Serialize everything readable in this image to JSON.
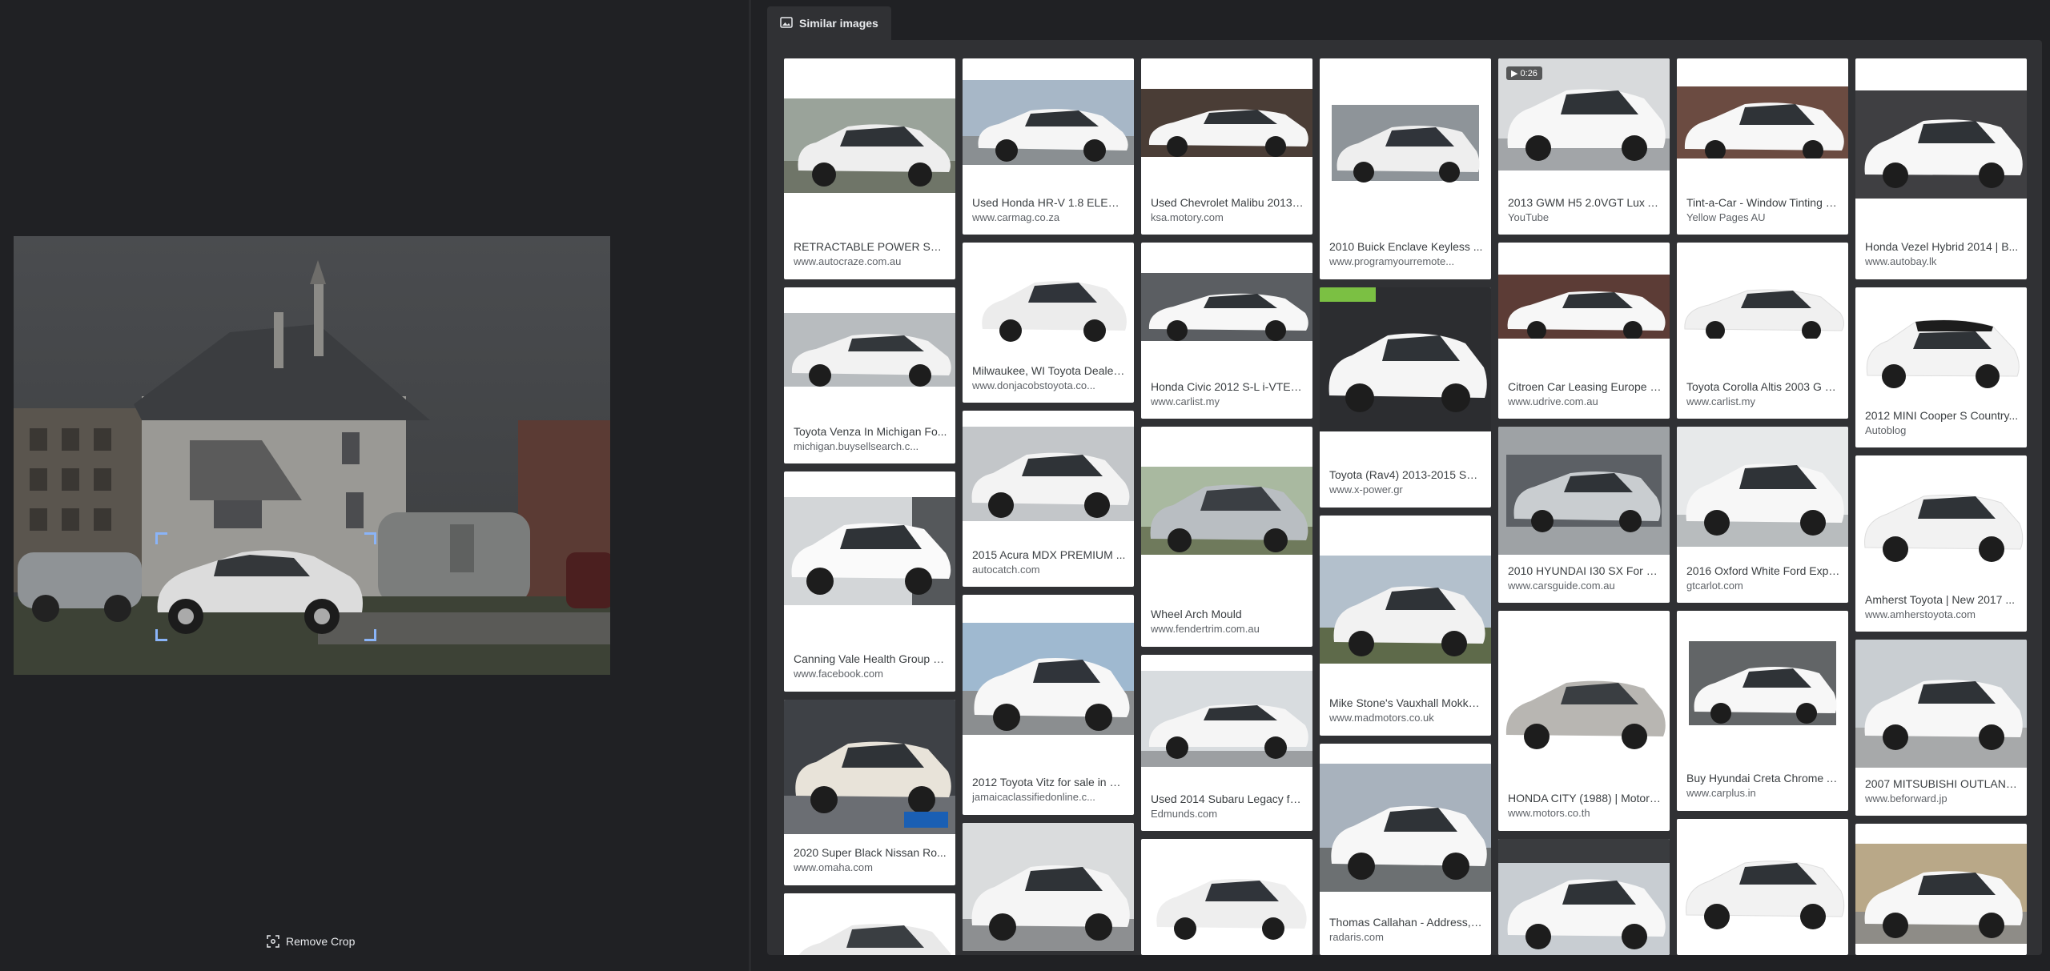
{
  "crop": {
    "remove_label": "Remove Crop"
  },
  "tab": {
    "label": "Similar images"
  },
  "results": [
    {
      "title": "RETRACTABLE POWER STEP...",
      "site": "www.autocraze.com.au"
    },
    {
      "title": "Used Honda HR-V 1.8 ELEGA...",
      "site": "www.carmag.co.za"
    },
    {
      "title": "Used Chevrolet Malibu 2013 ...",
      "site": "ksa.motory.com"
    },
    {
      "title": "2010 Buick Enclave Keyless ...",
      "site": "www.programyourremote..."
    },
    {
      "title": "2013 GWM H5 2.0VGT Lux A...",
      "site": "YouTube",
      "badge": "0:26"
    },
    {
      "title": "Tint-a-Car - Window Tinting - ...",
      "site": "Yellow Pages AU"
    },
    {
      "title": "Honda Vezel Hybrid 2014 | B...",
      "site": "www.autobay.lk"
    },
    {
      "title": "Toyota Venza In Michigan Fo...",
      "site": "michigan.buysellsearch.c..."
    },
    {
      "title": "Milwaukee, WI Toyota Dealer ...",
      "site": "www.donjacobstoyota.co..."
    },
    {
      "title": "Honda Civic 2012 S-L i-VTEC...",
      "site": "www.carlist.my"
    },
    {
      "title": "Toyota (Rav4) 2013-2015 SS...",
      "site": "www.x-power.gr"
    },
    {
      "title": "Citroen Car Leasing Europe - ...",
      "site": "www.udrive.com.au"
    },
    {
      "title": "Toyota Corolla Altis 2003 G 1...",
      "site": "www.carlist.my"
    },
    {
      "title": "2012 MINI Cooper S Country...",
      "site": "Autoblog"
    },
    {
      "title": "Canning Vale Health Group - ...",
      "site": "www.facebook.com"
    },
    {
      "title": "2015 Acura MDX PREMIUM ...",
      "site": "autocatch.com"
    },
    {
      "title": "Wheel Arch Mould",
      "site": "www.fendertrim.com.au"
    },
    {
      "title": "Mike Stone's Vauxhall Mokka...",
      "site": "www.madmotors.co.uk"
    },
    {
      "title": "2010 HYUNDAI I30 SX For Sa...",
      "site": "www.carsguide.com.au"
    },
    {
      "title": "2016 Oxford White Ford Expl...",
      "site": "gtcarlot.com"
    },
    {
      "title": "Amherst Toyota | New 2017 ...",
      "site": "www.amherstoyota.com"
    },
    {
      "title": "2020 Super Black Nissan Ro...",
      "site": "www.omaha.com"
    },
    {
      "title": "2012 Toyota Vitz for sale in K...",
      "site": "jamaicaclassifiedonline.c..."
    },
    {
      "title": "Used 2014 Subaru Legacy fo...",
      "site": "Edmunds.com"
    },
    {
      "title": "Thomas Callahan - Address, ...",
      "site": "radaris.com"
    },
    {
      "title": "HONDA CITY (1988) | Motors...",
      "site": "www.motors.co.th"
    },
    {
      "title": "Buy Hyundai Creta Chrome A...",
      "site": "www.carplus.in"
    },
    {
      "title": "2007 MITSUBISHI OUTLAND...",
      "site": "www.beforward.jp"
    }
  ]
}
